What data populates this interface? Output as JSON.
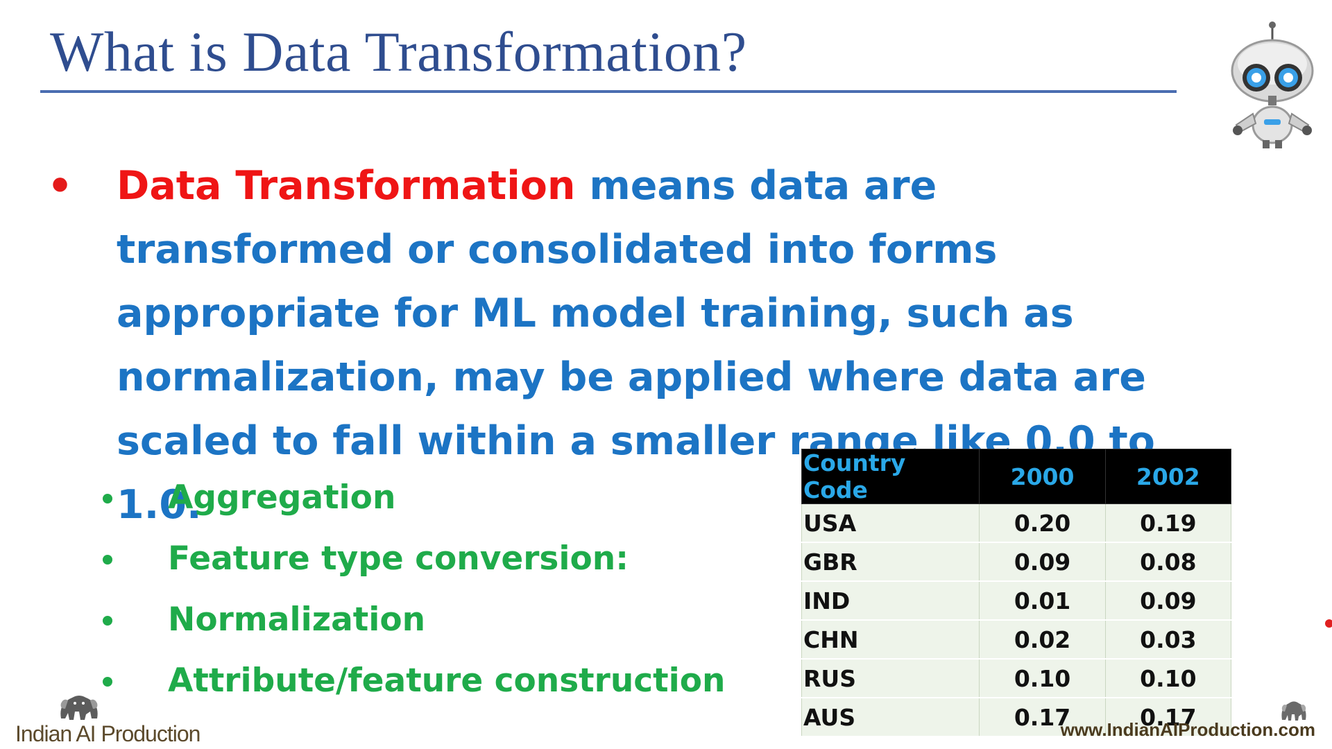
{
  "slide": {
    "title": "What is Data Transformation?",
    "main_point": {
      "term": "Data Transformation",
      "text": " means data are transformed or consolidated into forms appropriate for ML model training, such as normalization, may be applied where data are scaled to fall within a smaller range like 0.0 to 1.0."
    },
    "sub_points": [
      "Aggregation",
      "Feature type conversion:",
      "Normalization",
      "Attribute/feature construction"
    ],
    "table": {
      "headers": [
        "Country Code",
        "2000",
        "2002"
      ],
      "rows": [
        [
          "USA",
          "0.20",
          "0.19"
        ],
        [
          "GBR",
          "0.09",
          "0.08"
        ],
        [
          "IND",
          "0.01",
          "0.09"
        ],
        [
          "CHN",
          "0.02",
          "0.03"
        ],
        [
          "RUS",
          "0.10",
          "0.10"
        ],
        [
          "AUS",
          "0.17",
          "0.17"
        ]
      ]
    }
  },
  "branding": {
    "logo_text": "Indian AI Production",
    "website": "www.IndianAIProduction.com",
    "logo_icon": "elephant-icon"
  },
  "colors": {
    "title": "#2f4d8f",
    "rule": "#4a6db1",
    "term": "#ef1515",
    "body": "#1c74c4",
    "sub": "#1fab4a",
    "table_header_text": "#2aa8e8"
  },
  "decor": {
    "robot_icon": "robot-icon"
  }
}
